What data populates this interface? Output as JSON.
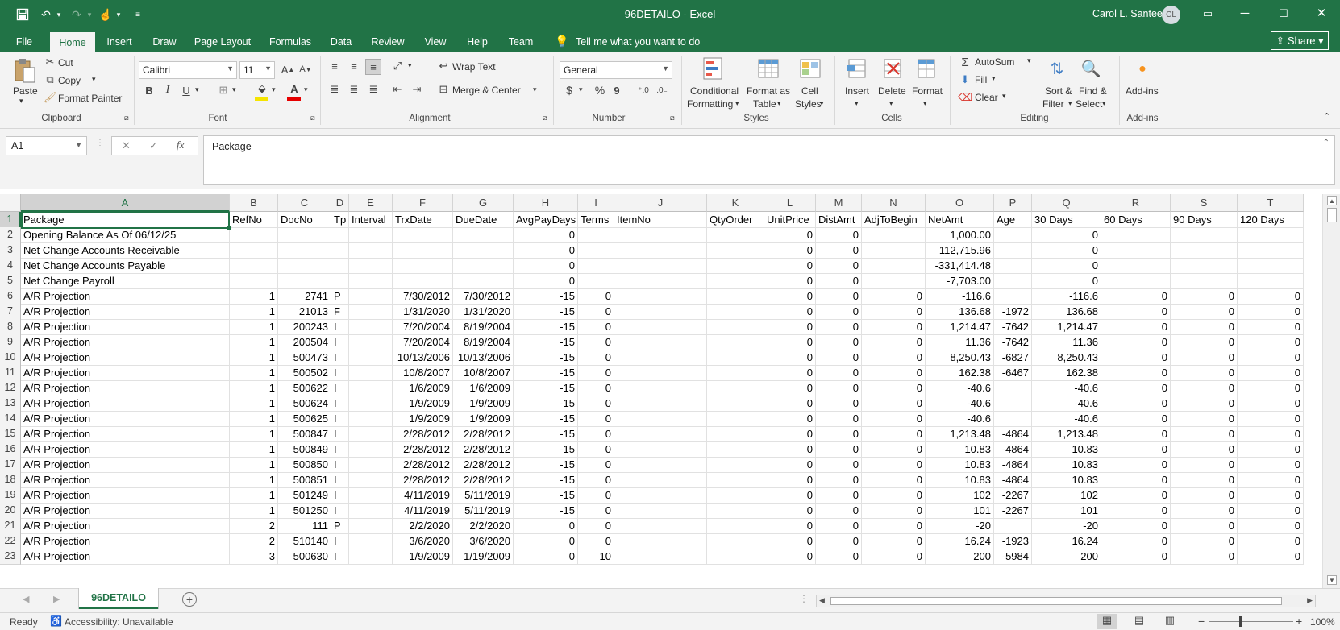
{
  "window": {
    "title": "96DETAILO  -  Excel",
    "user": "Carol L. Santee",
    "initials": "CL"
  },
  "menu_tabs": [
    "File",
    "Home",
    "Insert",
    "Draw",
    "Page Layout",
    "Formulas",
    "Data",
    "Review",
    "View",
    "Help",
    "Team"
  ],
  "tell_me": "Tell me what you want to do",
  "share": "Share",
  "ribbon": {
    "clipboard": {
      "paste": "Paste",
      "cut": "Cut",
      "copy": "Copy",
      "format_painter": "Format Painter",
      "label": "Clipboard"
    },
    "font": {
      "name": "Calibri",
      "size": "11",
      "bold": "B",
      "italic": "I",
      "underline": "U",
      "label": "Font"
    },
    "alignment": {
      "wrap_text": "Wrap Text",
      "merge_center": "Merge & Center",
      "label": "Alignment"
    },
    "number": {
      "format": "General",
      "currency": "$",
      "percent": "%",
      "comma": "9",
      "label": "Number"
    },
    "styles": {
      "conditional": [
        "Conditional",
        "Formatting"
      ],
      "format_table": [
        "Format as",
        "Table"
      ],
      "cell_styles": [
        "Cell",
        "Styles"
      ],
      "label": "Styles"
    },
    "cells": {
      "insert": "Insert",
      "delete": "Delete",
      "format": "Format",
      "label": "Cells"
    },
    "editing": {
      "autosum": "AutoSum",
      "fill": "Fill",
      "clear": "Clear",
      "sort_filter": [
        "Sort &",
        "Filter"
      ],
      "find_select": [
        "Find &",
        "Select"
      ],
      "label": "Editing"
    },
    "addins": {
      "addins": "Add-ins",
      "label": "Add-ins"
    }
  },
  "formula_bar": {
    "name_box": "A1",
    "fx": "fx",
    "content": "Package"
  },
  "columns": [
    "A",
    "B",
    "C",
    "D",
    "E",
    "F",
    "G",
    "H",
    "I",
    "J",
    "K",
    "L",
    "M",
    "N",
    "O",
    "P",
    "Q",
    "R",
    "S",
    "T"
  ],
  "rows": [
    [
      "Package",
      "RefNo",
      "DocNo",
      "Tp",
      "Interval",
      "TrxDate",
      "DueDate",
      "AvgPayDays",
      "Terms",
      "ItemNo",
      "QtyOrder",
      "UnitPrice",
      "DistAmt",
      "AdjToBegin",
      "NetAmt",
      "Age",
      "30 Days",
      "60 Days",
      "90 Days",
      "120 Days"
    ],
    [
      "Opening Balance As Of 06/12/25",
      "",
      "",
      "",
      "",
      "",
      "",
      "0",
      "",
      "",
      "",
      "0",
      "0",
      "",
      "1,000.00",
      "",
      "0",
      "",
      "",
      ""
    ],
    [
      "Net Change Accounts Receivable",
      "",
      "",
      "",
      "",
      "",
      "",
      "0",
      "",
      "",
      "",
      "0",
      "0",
      "",
      "112,715.96",
      "",
      "0",
      "",
      "",
      ""
    ],
    [
      "Net Change Accounts Payable",
      "",
      "",
      "",
      "",
      "",
      "",
      "0",
      "",
      "",
      "",
      "0",
      "0",
      "",
      "-331,414.48",
      "",
      "0",
      "",
      "",
      ""
    ],
    [
      "Net Change Payroll",
      "",
      "",
      "",
      "",
      "",
      "",
      "0",
      "",
      "",
      "",
      "0",
      "0",
      "",
      "-7,703.00",
      "",
      "0",
      "",
      "",
      ""
    ],
    [
      "A/R Projection",
      "1",
      "2741",
      "P",
      "",
      "7/30/2012",
      "7/30/2012",
      "-15",
      "0",
      "",
      "",
      "0",
      "0",
      "0",
      "-116.6",
      "",
      "-116.6",
      "0",
      "0",
      "0"
    ],
    [
      "A/R Projection",
      "1",
      "21013",
      "F",
      "",
      "1/31/2020",
      "1/31/2020",
      "-15",
      "0",
      "",
      "",
      "0",
      "0",
      "0",
      "136.68",
      "-1972",
      "136.68",
      "0",
      "0",
      "0"
    ],
    [
      "A/R Projection",
      "1",
      "200243",
      "I",
      "",
      "7/20/2004",
      "8/19/2004",
      "-15",
      "0",
      "",
      "",
      "0",
      "0",
      "0",
      "1,214.47",
      "-7642",
      "1,214.47",
      "0",
      "0",
      "0"
    ],
    [
      "A/R Projection",
      "1",
      "200504",
      "I",
      "",
      "7/20/2004",
      "8/19/2004",
      "-15",
      "0",
      "",
      "",
      "0",
      "0",
      "0",
      "11.36",
      "-7642",
      "11.36",
      "0",
      "0",
      "0"
    ],
    [
      "A/R Projection",
      "1",
      "500473",
      "I",
      "",
      "10/13/2006",
      "10/13/2006",
      "-15",
      "0",
      "",
      "",
      "0",
      "0",
      "0",
      "8,250.43",
      "-6827",
      "8,250.43",
      "0",
      "0",
      "0"
    ],
    [
      "A/R Projection",
      "1",
      "500502",
      "I",
      "",
      "10/8/2007",
      "10/8/2007",
      "-15",
      "0",
      "",
      "",
      "0",
      "0",
      "0",
      "162.38",
      "-6467",
      "162.38",
      "0",
      "0",
      "0"
    ],
    [
      "A/R Projection",
      "1",
      "500622",
      "I",
      "",
      "1/6/2009",
      "1/6/2009",
      "-15",
      "0",
      "",
      "",
      "0",
      "0",
      "0",
      "-40.6",
      "",
      "-40.6",
      "0",
      "0",
      "0"
    ],
    [
      "A/R Projection",
      "1",
      "500624",
      "I",
      "",
      "1/9/2009",
      "1/9/2009",
      "-15",
      "0",
      "",
      "",
      "0",
      "0",
      "0",
      "-40.6",
      "",
      "-40.6",
      "0",
      "0",
      "0"
    ],
    [
      "A/R Projection",
      "1",
      "500625",
      "I",
      "",
      "1/9/2009",
      "1/9/2009",
      "-15",
      "0",
      "",
      "",
      "0",
      "0",
      "0",
      "-40.6",
      "",
      "-40.6",
      "0",
      "0",
      "0"
    ],
    [
      "A/R Projection",
      "1",
      "500847",
      "I",
      "",
      "2/28/2012",
      "2/28/2012",
      "-15",
      "0",
      "",
      "",
      "0",
      "0",
      "0",
      "1,213.48",
      "-4864",
      "1,213.48",
      "0",
      "0",
      "0"
    ],
    [
      "A/R Projection",
      "1",
      "500849",
      "I",
      "",
      "2/28/2012",
      "2/28/2012",
      "-15",
      "0",
      "",
      "",
      "0",
      "0",
      "0",
      "10.83",
      "-4864",
      "10.83",
      "0",
      "0",
      "0"
    ],
    [
      "A/R Projection",
      "1",
      "500850",
      "I",
      "",
      "2/28/2012",
      "2/28/2012",
      "-15",
      "0",
      "",
      "",
      "0",
      "0",
      "0",
      "10.83",
      "-4864",
      "10.83",
      "0",
      "0",
      "0"
    ],
    [
      "A/R Projection",
      "1",
      "500851",
      "I",
      "",
      "2/28/2012",
      "2/28/2012",
      "-15",
      "0",
      "",
      "",
      "0",
      "0",
      "0",
      "10.83",
      "-4864",
      "10.83",
      "0",
      "0",
      "0"
    ],
    [
      "A/R Projection",
      "1",
      "501249",
      "I",
      "",
      "4/11/2019",
      "5/11/2019",
      "-15",
      "0",
      "",
      "",
      "0",
      "0",
      "0",
      "102",
      "-2267",
      "102",
      "0",
      "0",
      "0"
    ],
    [
      "A/R Projection",
      "1",
      "501250",
      "I",
      "",
      "4/11/2019",
      "5/11/2019",
      "-15",
      "0",
      "",
      "",
      "0",
      "0",
      "0",
      "101",
      "-2267",
      "101",
      "0",
      "0",
      "0"
    ],
    [
      "A/R Projection",
      "2",
      "111",
      "P",
      "",
      "2/2/2020",
      "2/2/2020",
      "0",
      "0",
      "",
      "",
      "0",
      "0",
      "0",
      "-20",
      "",
      "-20",
      "0",
      "0",
      "0"
    ],
    [
      "A/R Projection",
      "2",
      "510140",
      "I",
      "",
      "3/6/2020",
      "3/6/2020",
      "0",
      "0",
      "",
      "",
      "0",
      "0",
      "0",
      "16.24",
      "-1923",
      "16.24",
      "0",
      "0",
      "0"
    ],
    [
      "A/R Projection",
      "3",
      "500630",
      "I",
      "",
      "1/9/2009",
      "1/19/2009",
      "0",
      "10",
      "",
      "",
      "0",
      "0",
      "0",
      "200",
      "-5984",
      "200",
      "0",
      "0",
      "0"
    ]
  ],
  "sheet_tab": "96DETAILO",
  "status": {
    "ready": "Ready",
    "accessibility": "Accessibility: Unavailable",
    "zoom": "100%"
  }
}
